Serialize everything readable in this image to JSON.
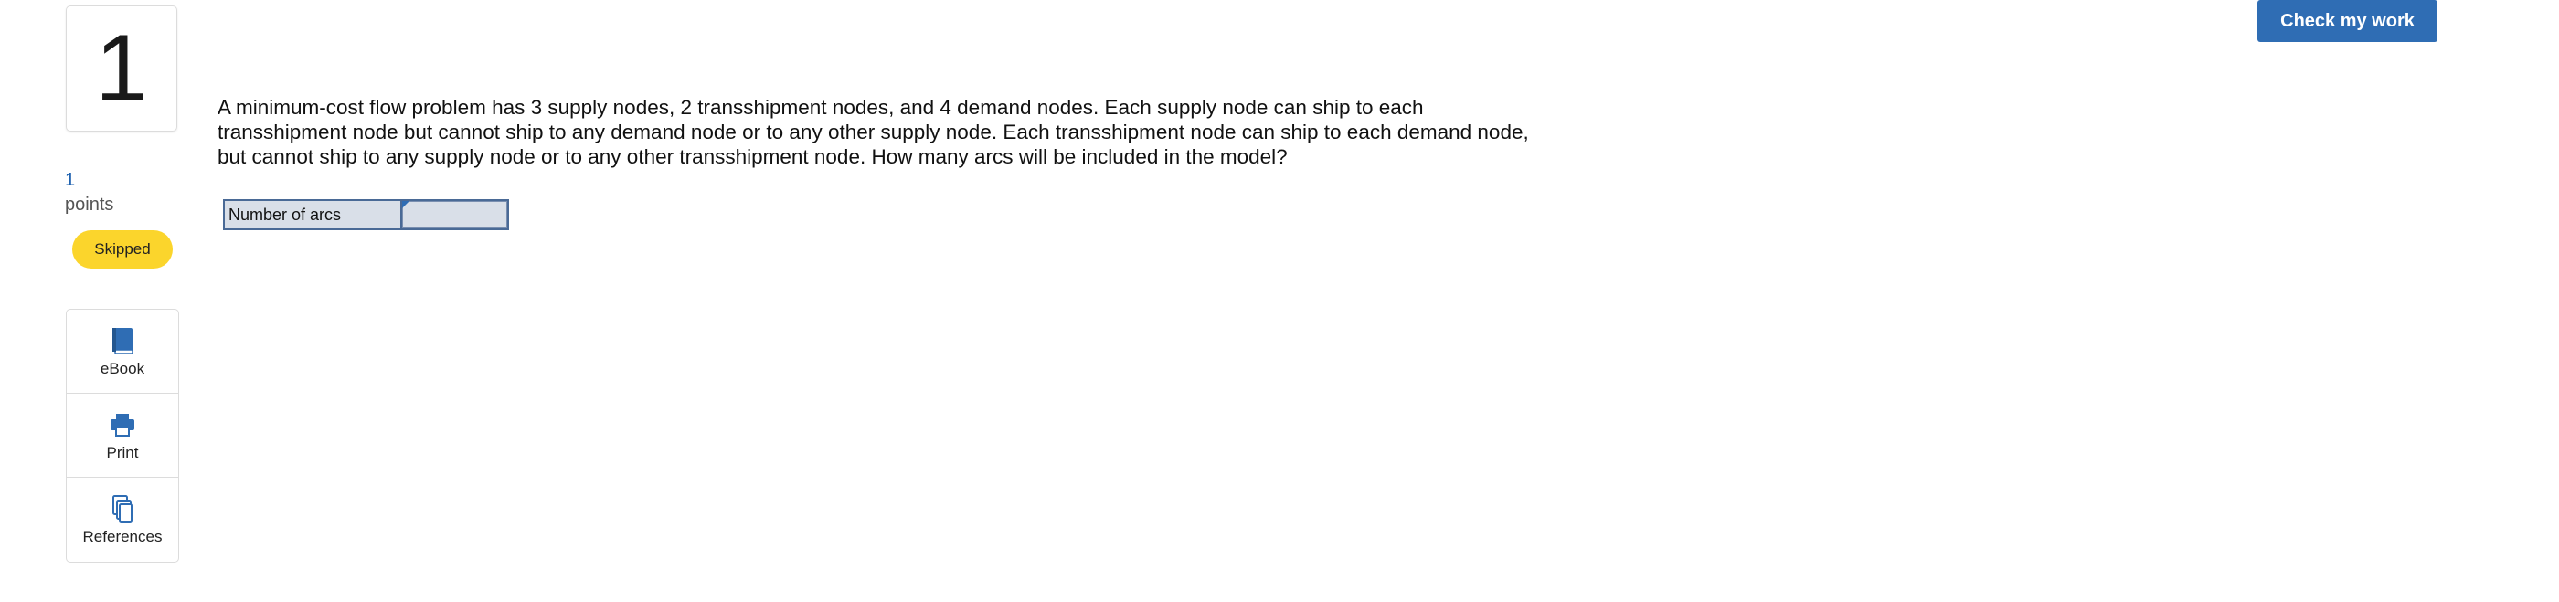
{
  "question": {
    "number": "1",
    "points_value": "1",
    "points_label": "points",
    "status": "Skipped",
    "text": "A minimum-cost flow problem has 3 supply nodes, 2 transshipment nodes, and 4 demand nodes. Each supply node can ship to each transshipment node but cannot ship to any demand node or to any other supply node. Each transshipment node can ship to each demand node, but cannot ship to any supply node or to any other transshipment node. How many arcs will be included in the model?"
  },
  "header": {
    "check_label": "Check my work"
  },
  "tools": [
    {
      "label": "eBook",
      "icon": "book-icon"
    },
    {
      "label": "Print",
      "icon": "printer-icon"
    },
    {
      "label": "References",
      "icon": "documents-icon"
    }
  ],
  "answer": {
    "label": "Number of arcs",
    "value": ""
  },
  "colors": {
    "accent": "#2f6db4",
    "link": "#1b5fae",
    "badge": "#fbd52c",
    "input_bg": "#d9dfe8"
  }
}
